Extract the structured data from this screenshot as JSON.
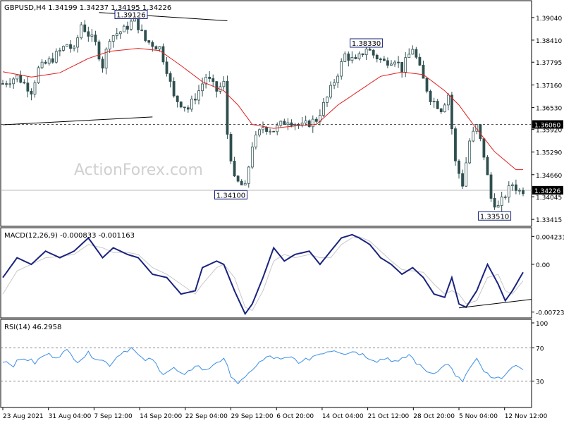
{
  "chart_data": [
    {
      "type": "candlestick",
      "header": "GBPUSD,H4  1.34199 1.34237 1.34195 1.34226",
      "watermark": "ActionForex.com",
      "yticks": [
        1.3904,
        1.3841,
        1.37795,
        1.3716,
        1.3653,
        1.3592,
        1.3529,
        1.3466,
        1.34045,
        1.33415
      ],
      "ytick_labels": [
        "1.39040",
        "1.38410",
        "1.37795",
        "1.37160",
        "1.36530",
        "1.35920",
        "1.35290",
        "1.34660",
        "1.34045",
        "1.33415"
      ],
      "ylim": [
        1.3328,
        1.3945
      ],
      "price_levels": [
        {
          "label": "1.36060",
          "value": 1.3606,
          "style": "dashed"
        },
        {
          "label": "1.34226",
          "value": 1.34226,
          "style": "current"
        }
      ],
      "annotations": [
        {
          "label": "1.39126",
          "value": 1.39126,
          "bar": 36
        },
        {
          "label": "1.38330",
          "value": 1.3833,
          "bar": 102
        },
        {
          "label": "1.34100",
          "value": 1.341,
          "bar": 64
        },
        {
          "label": "1.33510",
          "value": 1.3351,
          "bar": 138
        }
      ],
      "trendlines": [
        {
          "from": [
            0,
            1.3605
          ],
          "to": [
            42,
            1.3627
          ]
        },
        {
          "from": [
            27,
            1.3918
          ],
          "to": [
            63,
            1.3895
          ]
        }
      ],
      "ma_period_label": "SMA",
      "ma_anchors": [
        [
          0,
          1.3753
        ],
        [
          8,
          1.3738
        ],
        [
          16,
          1.375
        ],
        [
          24,
          1.379
        ],
        [
          30,
          1.381
        ],
        [
          38,
          1.3818
        ],
        [
          44,
          1.3812
        ],
        [
          50,
          1.377
        ],
        [
          56,
          1.3725
        ],
        [
          62,
          1.37
        ],
        [
          66,
          1.366
        ],
        [
          70,
          1.3606
        ],
        [
          76,
          1.3595
        ],
        [
          82,
          1.3602
        ],
        [
          88,
          1.3606
        ],
        [
          94,
          1.366
        ],
        [
          100,
          1.37
        ],
        [
          106,
          1.374
        ],
        [
          112,
          1.3752
        ],
        [
          118,
          1.3745
        ],
        [
          124,
          1.37
        ],
        [
          128,
          1.366
        ],
        [
          132,
          1.3606
        ],
        [
          138,
          1.353
        ],
        [
          144,
          1.348
        ]
      ],
      "price_anchors": [
        [
          0,
          1.372
        ],
        [
          4,
          1.374
        ],
        [
          8,
          1.37
        ],
        [
          10,
          1.376
        ],
        [
          14,
          1.379
        ],
        [
          18,
          1.383
        ],
        [
          20,
          1.381
        ],
        [
          22,
          1.3885
        ],
        [
          26,
          1.383
        ],
        [
          28,
          1.377
        ],
        [
          30,
          1.385
        ],
        [
          34,
          1.387
        ],
        [
          37,
          1.39
        ],
        [
          40,
          1.384
        ],
        [
          44,
          1.382
        ],
        [
          46,
          1.376
        ],
        [
          48,
          1.368
        ],
        [
          52,
          1.365
        ],
        [
          55,
          1.37
        ],
        [
          57,
          1.374
        ],
        [
          60,
          1.37
        ],
        [
          62,
          1.372
        ],
        [
          63,
          1.358
        ],
        [
          65,
          1.345
        ],
        [
          68,
          1.343
        ],
        [
          70,
          1.355
        ],
        [
          73,
          1.36
        ],
        [
          76,
          1.359
        ],
        [
          80,
          1.362
        ],
        [
          84,
          1.36
        ],
        [
          88,
          1.362
        ],
        [
          91,
          1.368
        ],
        [
          94,
          1.375
        ],
        [
          96,
          1.38
        ],
        [
          99,
          1.378
        ],
        [
          102,
          1.382
        ],
        [
          104,
          1.38
        ],
        [
          107,
          1.378
        ],
        [
          110,
          1.379
        ],
        [
          112,
          1.376
        ],
        [
          115,
          1.382
        ],
        [
          118,
          1.373
        ],
        [
          120,
          1.368
        ],
        [
          123,
          1.365
        ],
        [
          125,
          1.369
        ],
        [
          127,
          1.35
        ],
        [
          129,
          1.344
        ],
        [
          131,
          1.356
        ],
        [
          133,
          1.36
        ],
        [
          135,
          1.352
        ],
        [
          137,
          1.34
        ],
        [
          139,
          1.3375
        ],
        [
          141,
          1.341
        ],
        [
          143,
          1.344
        ],
        [
          145,
          1.342
        ],
        [
          146,
          1.3423
        ]
      ],
      "bar_count": 147
    },
    {
      "type": "line",
      "title": "MACD(12,26,9) -0.000833 -0.001163",
      "yticks": [
        0.004231,
        0.0,
        -0.00723
      ],
      "ytick_labels": [
        "0.004231",
        "0.00",
        "-0.00723"
      ],
      "ylim": [
        -0.0078,
        0.0048
      ],
      "series": [
        {
          "name": "MACD",
          "color": "#1a237e",
          "anchors": [
            [
              0,
              -0.002
            ],
            [
              4,
              0.001
            ],
            [
              8,
              0.0
            ],
            [
              12,
              0.002
            ],
            [
              16,
              0.001
            ],
            [
              20,
              0.002
            ],
            [
              24,
              0.004
            ],
            [
              28,
              0.001
            ],
            [
              31,
              0.0025
            ],
            [
              35,
              0.0015
            ],
            [
              38,
              0.001
            ],
            [
              42,
              -0.0015
            ],
            [
              46,
              -0.002
            ],
            [
              50,
              -0.0045
            ],
            [
              54,
              -0.004
            ],
            [
              56,
              -0.0005
            ],
            [
              60,
              0.0005
            ],
            [
              62,
              0.0
            ],
            [
              65,
              -0.004
            ],
            [
              68,
              -0.0075
            ],
            [
              70,
              -0.006
            ],
            [
              73,
              -0.002
            ],
            [
              76,
              0.0025
            ],
            [
              79,
              0.0005
            ],
            [
              82,
              0.0015
            ],
            [
              86,
              0.002
            ],
            [
              89,
              0.0
            ],
            [
              92,
              0.002
            ],
            [
              95,
              0.004
            ],
            [
              98,
              0.0045
            ],
            [
              100,
              0.004
            ],
            [
              103,
              0.003
            ],
            [
              106,
              0.001
            ],
            [
              109,
              0.0
            ],
            [
              112,
              -0.0015
            ],
            [
              115,
              -0.0005
            ],
            [
              118,
              -0.002
            ],
            [
              121,
              -0.0045
            ],
            [
              124,
              -0.005
            ],
            [
              126,
              -0.002
            ],
            [
              128,
              -0.006
            ],
            [
              130,
              -0.0065
            ],
            [
              133,
              -0.004
            ],
            [
              136,
              0.0
            ],
            [
              139,
              -0.003
            ],
            [
              141,
              -0.0055
            ],
            [
              143,
              -0.004
            ],
            [
              146,
              -0.0012
            ]
          ]
        },
        {
          "name": "Signal",
          "color": "#c8c8c8",
          "anchors": [
            [
              0,
              -0.0045
            ],
            [
              4,
              -0.001
            ],
            [
              8,
              0.0
            ],
            [
              12,
              0.001
            ],
            [
              16,
              0.0012
            ],
            [
              20,
              0.0015
            ],
            [
              24,
              0.003
            ],
            [
              28,
              0.0025
            ],
            [
              31,
              0.0018
            ],
            [
              35,
              0.0018
            ],
            [
              38,
              0.0015
            ],
            [
              42,
              -0.0005
            ],
            [
              46,
              -0.0015
            ],
            [
              50,
              -0.003
            ],
            [
              54,
              -0.0045
            ],
            [
              56,
              -0.003
            ],
            [
              60,
              -0.0005
            ],
            [
              62,
              0.0
            ],
            [
              65,
              -0.002
            ],
            [
              68,
              -0.0065
            ],
            [
              70,
              -0.007
            ],
            [
              73,
              -0.004
            ],
            [
              76,
              0.0005
            ],
            [
              79,
              0.0015
            ],
            [
              82,
              0.001
            ],
            [
              86,
              0.0015
            ],
            [
              89,
              0.001
            ],
            [
              92,
              0.001
            ],
            [
              95,
              0.003
            ],
            [
              98,
              0.004
            ],
            [
              100,
              0.0042
            ],
            [
              103,
              0.0035
            ],
            [
              106,
              0.002
            ],
            [
              109,
              0.0005
            ],
            [
              112,
              -0.0008
            ],
            [
              115,
              -0.001
            ],
            [
              118,
              -0.0012
            ],
            [
              121,
              -0.003
            ],
            [
              124,
              -0.0045
            ],
            [
              126,
              -0.004
            ],
            [
              128,
              -0.0045
            ],
            [
              130,
              -0.006
            ],
            [
              133,
              -0.0055
            ],
            [
              136,
              -0.002
            ],
            [
              139,
              -0.0015
            ],
            [
              141,
              -0.004
            ],
            [
              143,
              -0.0045
            ],
            [
              146,
              -0.0025
            ]
          ]
        }
      ],
      "trendline": {
        "from": [
          128,
          -0.0066
        ],
        "to": [
          150,
          -0.0053
        ]
      }
    },
    {
      "type": "line",
      "title": "RSI(14) 46.2958",
      "yticks": [
        100,
        70,
        30
      ],
      "ytick_labels": [
        "100",
        "70",
        "30"
      ],
      "ylim": [
        0,
        100
      ],
      "levels": [
        70,
        30
      ],
      "series": [
        {
          "name": "RSI",
          "color": "#3a8ee6",
          "anchors": [
            [
              0,
              55
            ],
            [
              3,
              50
            ],
            [
              6,
              58
            ],
            [
              9,
              52
            ],
            [
              12,
              62
            ],
            [
              15,
              60
            ],
            [
              18,
              66
            ],
            [
              21,
              55
            ],
            [
              24,
              63
            ],
            [
              27,
              57
            ],
            [
              30,
              50
            ],
            [
              33,
              64
            ],
            [
              36,
              70
            ],
            [
              39,
              56
            ],
            [
              42,
              55
            ],
            [
              45,
              40
            ],
            [
              48,
              45
            ],
            [
              51,
              35
            ],
            [
              54,
              50
            ],
            [
              57,
              42
            ],
            [
              60,
              54
            ],
            [
              62,
              55
            ],
            [
              64,
              38
            ],
            [
              66,
              28
            ],
            [
              68,
              32
            ],
            [
              70,
              45
            ],
            [
              72,
              52
            ],
            [
              75,
              60
            ],
            [
              78,
              55
            ],
            [
              81,
              58
            ],
            [
              84,
              52
            ],
            [
              87,
              60
            ],
            [
              90,
              65
            ],
            [
              93,
              68
            ],
            [
              96,
              64
            ],
            [
              99,
              66
            ],
            [
              102,
              60
            ],
            [
              105,
              55
            ],
            [
              108,
              58
            ],
            [
              111,
              52
            ],
            [
              114,
              62
            ],
            [
              117,
              48
            ],
            [
              120,
              40
            ],
            [
              123,
              45
            ],
            [
              125,
              52
            ],
            [
              127,
              35
            ],
            [
              129,
              30
            ],
            [
              131,
              45
            ],
            [
              133,
              55
            ],
            [
              135,
              42
            ],
            [
              137,
              33
            ],
            [
              139,
              32
            ],
            [
              141,
              40
            ],
            [
              143,
              44
            ],
            [
              145,
              48
            ],
            [
              146,
              46.3
            ]
          ]
        }
      ]
    }
  ],
  "x_axis": {
    "labels": [
      "23 Aug 2021",
      "31 Aug 04:00",
      "7 Sep 12:00",
      "14 Sep 20:00",
      "22 Sep 04:00",
      "29 Sep 12:00",
      "6 Oct 20:00",
      "14 Oct 04:00",
      "21 Oct 12:00",
      "28 Oct 20:00",
      "5 Nov 04:00",
      "12 Nov 12:00"
    ],
    "label_bars": [
      0,
      12.8,
      25.6,
      38.4,
      51.2,
      64,
      76.8,
      89.6,
      102.4,
      115.2,
      128,
      140.8
    ]
  },
  "colors": {
    "candle": "#2f4f4f",
    "ma": "#e02020",
    "grid_dashed": "#555555",
    "label_border": "#1a237e"
  }
}
